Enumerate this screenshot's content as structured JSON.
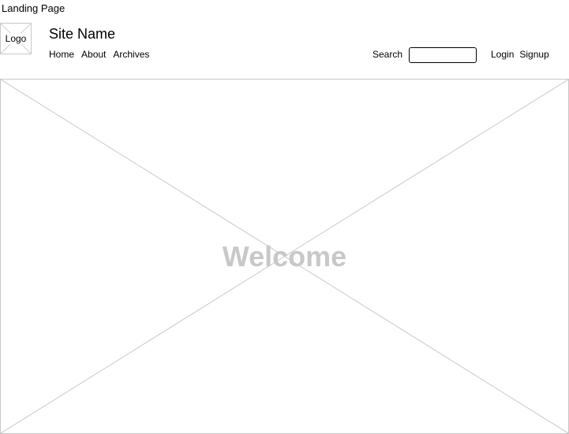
{
  "page": {
    "title": "Landing Page"
  },
  "header": {
    "logo_label": "Logo",
    "site_name": "Site Name",
    "nav": [
      {
        "label": "Home"
      },
      {
        "label": "About"
      },
      {
        "label": "Archives"
      }
    ],
    "search": {
      "label": "Search",
      "value": "",
      "placeholder": ""
    },
    "auth": {
      "login_label": "Login",
      "signup_label": "Signup"
    }
  },
  "hero": {
    "text": "Welcome"
  },
  "colors": {
    "placeholder_stroke": "#c8c8c8",
    "hero_text": "#c8c8c8",
    "text": "#000000",
    "background": "#ffffff"
  }
}
